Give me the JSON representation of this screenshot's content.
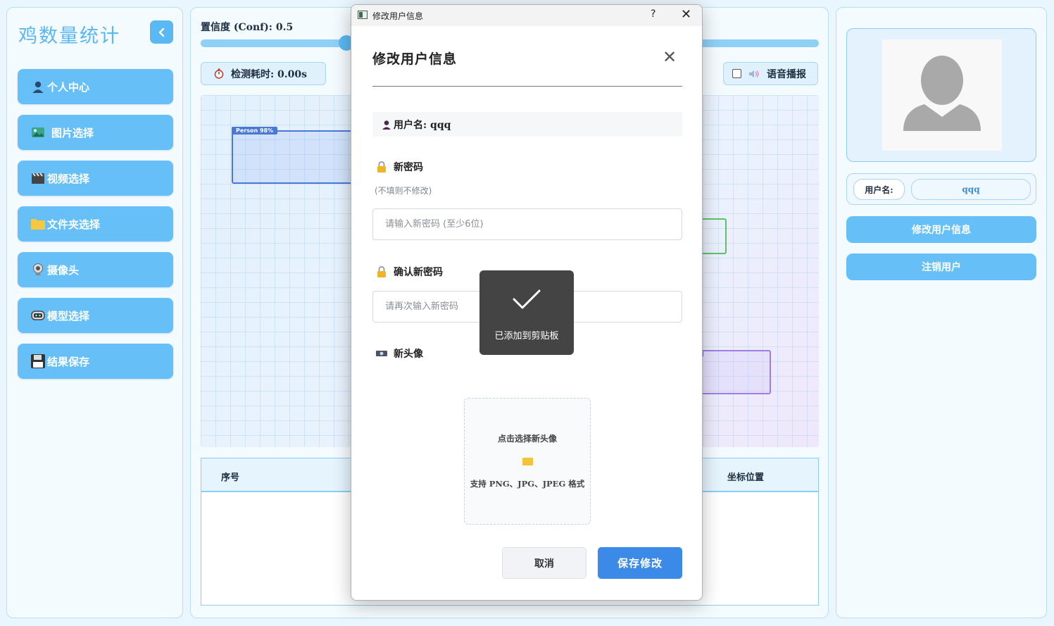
{
  "app": {
    "title": "鸡数量统计",
    "colors": {
      "accent": "#66c0f7",
      "primary_button": "#3c8ae8",
      "background": "#eaf6fd"
    }
  },
  "sidebar": {
    "items": [
      {
        "label": "个人中心",
        "icon": "user-icon"
      },
      {
        "label": "图片选择",
        "icon": "image-icon"
      },
      {
        "label": "视频选择",
        "icon": "clapper-icon"
      },
      {
        "label": "文件夹选择",
        "icon": "folder-icon"
      },
      {
        "label": "摄像头",
        "icon": "camera-icon"
      },
      {
        "label": "模型选择",
        "icon": "robot-icon"
      },
      {
        "label": "结果保存",
        "icon": "floppy-disk-icon"
      }
    ]
  },
  "main": {
    "confidence_label": "置信度 (Conf): 0.5",
    "confidence_value": 0.5,
    "timer_label": "检测耗时: 0.00s",
    "voice_label": "语音播报",
    "voice_enabled": false,
    "detection_label": "Person 98%",
    "table": {
      "col_index": "序号",
      "col_position": "坐标位置",
      "rows": []
    }
  },
  "profile": {
    "username_tag": "用户名:",
    "username_value": "qqq",
    "edit_button": "修改用户信息",
    "logout_button": "注销用户"
  },
  "dialog": {
    "window_title": "修改用户信息",
    "help": "?",
    "heading": "修改用户信息",
    "username_line": "用户名: qqq",
    "new_password_label": "新密码",
    "new_password_hint": "(不填则不修改)",
    "new_password_placeholder": "请输入新密码 (至少6位)",
    "confirm_password_label": "确认新密码",
    "confirm_password_placeholder": "请再次输入新密码",
    "new_avatar_label": "新头像",
    "upload_title": "点击选择新头像",
    "upload_formats": "支持 PNG、JPG、JPEG 格式",
    "cancel_button": "取消",
    "save_button": "保存修改"
  },
  "toast": {
    "message": "已添加到剪贴板"
  }
}
